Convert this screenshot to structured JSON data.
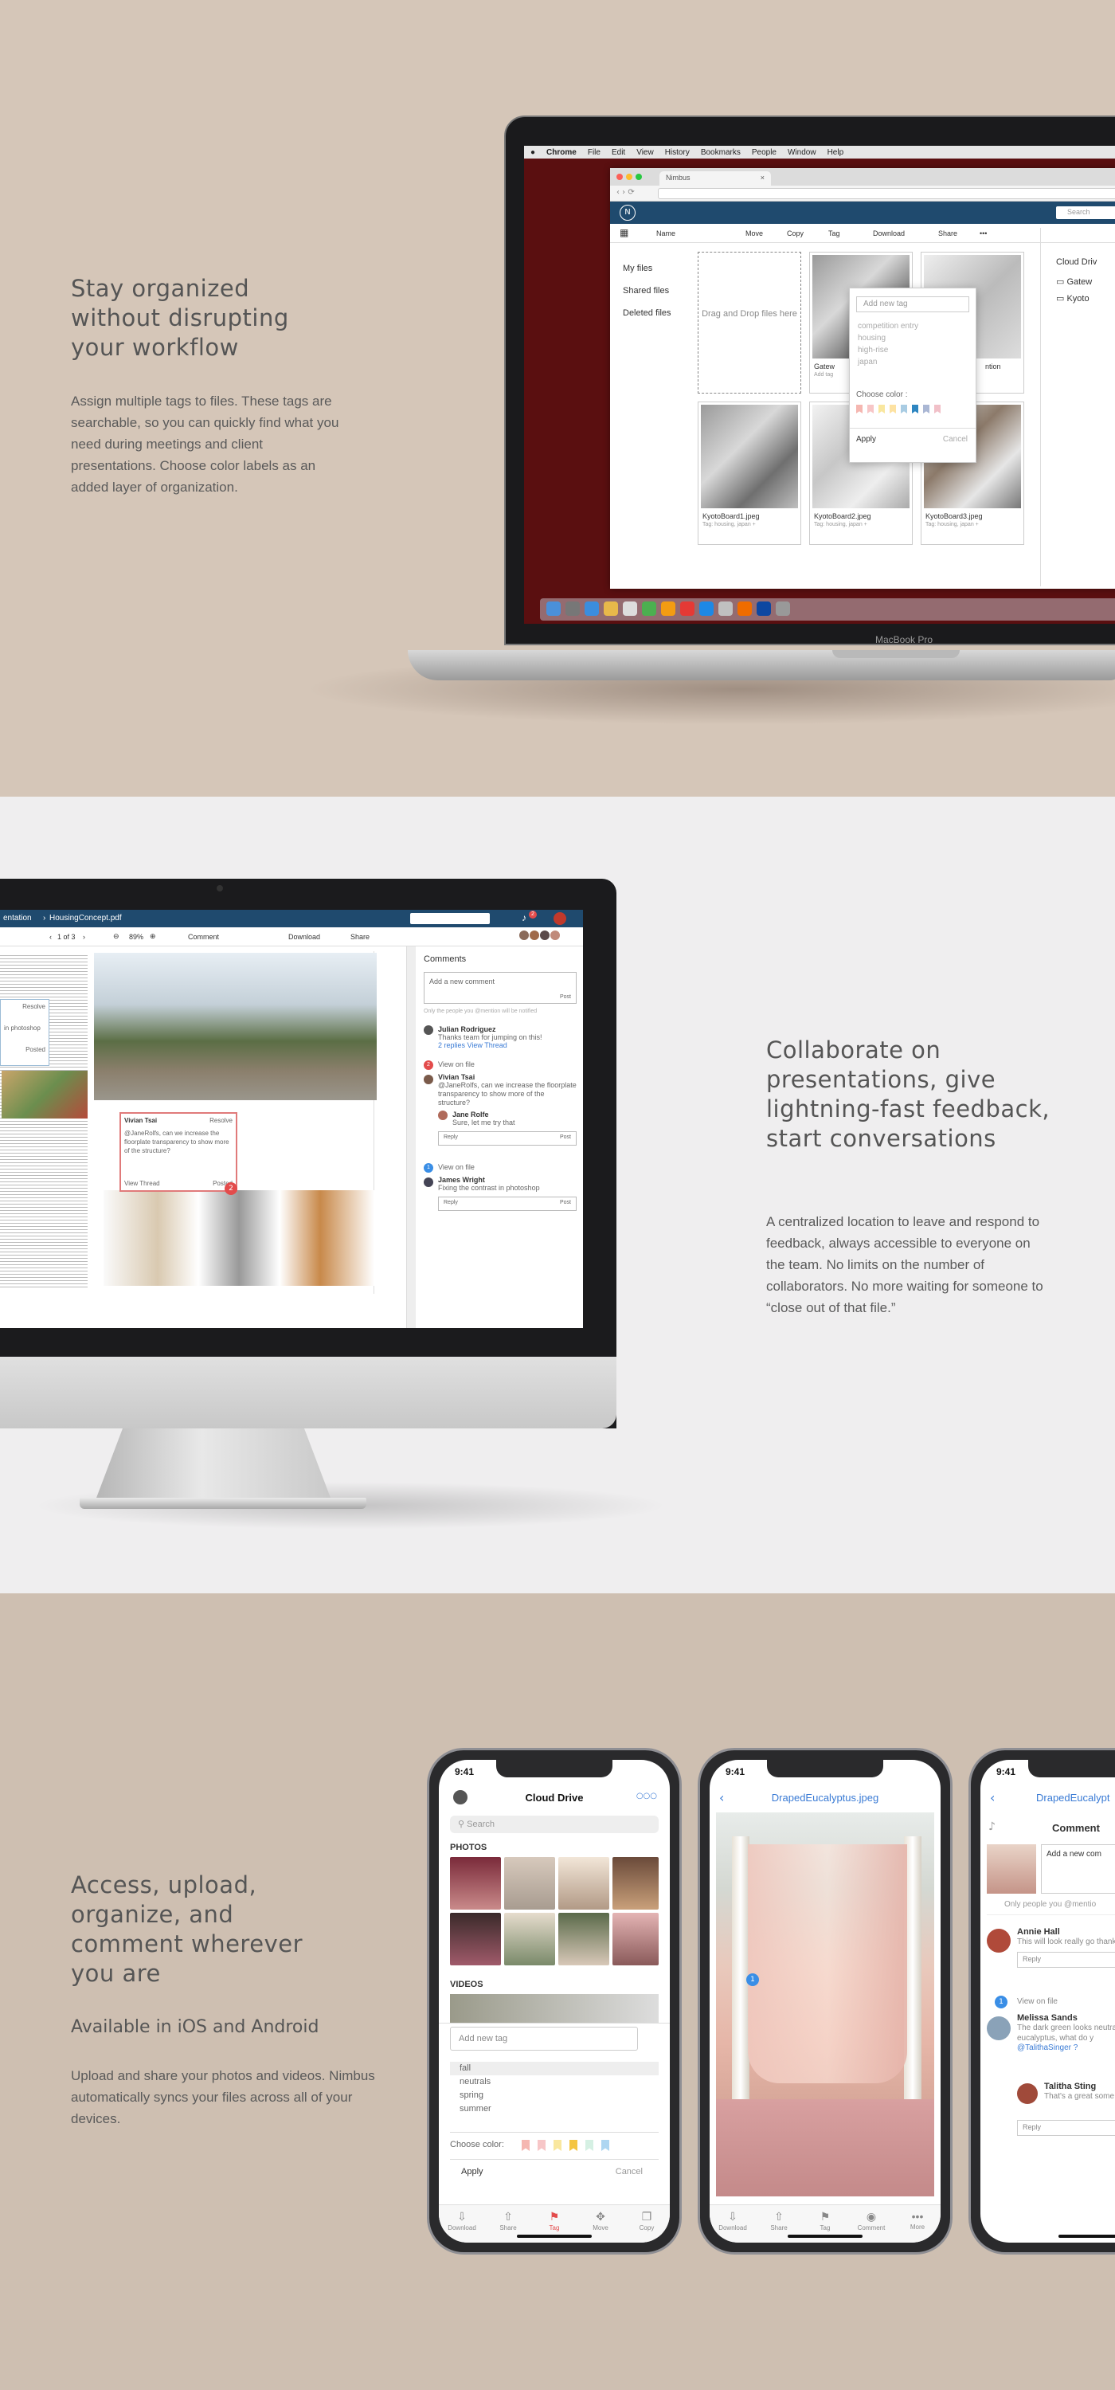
{
  "section1": {
    "heading": "Stay organized without disrupting your workflow",
    "body": "Assign multiple tags to files. These tags are searchable, so you can quickly find what you need during meetings and client presentations. Choose color labels as an added layer of organization.",
    "laptop_model": "MacBook Pro",
    "mac_menu": [
      "Chrome",
      "File",
      "Edit",
      "View",
      "History",
      "Bookmarks",
      "People",
      "Window",
      "Help"
    ],
    "browser_tab": "Nimbus",
    "app_logo": "N",
    "app_search_placeholder": "Search",
    "toolbar": {
      "sort": "Name",
      "move": "Move",
      "copy": "Copy",
      "tag": "Tag",
      "download": "Download",
      "share": "Share",
      "more": "•••"
    },
    "sidenav": [
      "My files",
      "Shared files",
      "Deleted files"
    ],
    "dropzone": "Drag and Drop files here",
    "thumbs": [
      {
        "name": "KyotoBoard1.jpeg",
        "tag": "Tag: housing, japan +"
      },
      {
        "name": "KyotoBoard2.jpeg",
        "tag": "Tag: housing, japan +"
      },
      {
        "name": "KyotoBoard3.jpeg",
        "tag": "Tag: housing, japan +"
      }
    ],
    "top_thumb_1": "Gatew",
    "top_thumb_1_tag": "Add tag",
    "top_thumb_2": "ntion",
    "tag_popup": {
      "placeholder": "Add new tag",
      "options": [
        "competition entry",
        "housing",
        "high-rise",
        "japan"
      ],
      "choose_color": "Choose color :",
      "apply": "Apply",
      "cancel": "Cancel",
      "colors": [
        "#f5b7b1",
        "#f7c6c7",
        "#f9e79f",
        "#fde2a2",
        "#a9cce3",
        "#2e86c1",
        "#aab7d4",
        "#f1c0c8"
      ]
    },
    "cloud_panel": {
      "title": "Cloud Driv",
      "items": [
        "Gatew",
        "Kyoto"
      ]
    }
  },
  "section2": {
    "heading": "Collaborate on presentations, give lightning-fast feedback, start conversations",
    "body": "A centralized location to leave and respond to feedback, always accessible to everyone on the team.  No limits on the number of collaborators. No more waiting for someone to “close out of that file.”",
    "breadcrumb_prev": "entation",
    "breadcrumb_file": "HousingConcept.pdf",
    "pager": "1 of 3",
    "zoom": "89%",
    "comment_btn": "Comment",
    "download": "Download",
    "share": "Share",
    "notif_count": "2",
    "comments_title": "Comments",
    "new_comment_placeholder": "Add a new comment",
    "post": "Post",
    "notify_note": "Only the people you @mention will be notified",
    "side_label": "Resolve",
    "side_label_2": "in photoshop",
    "side_label_3": "Posted",
    "card": {
      "author": "Vivian Tsai",
      "resolve": "Resolve",
      "text": "@JaneRolfs, can we increase the floorplate transparency to show more of the structure?",
      "view_thread": "View Thread",
      "posted": "Posted"
    },
    "pin": "2",
    "thread": [
      {
        "author": "Julian Rodriguez",
        "text": "Thanks team for jumping on this!",
        "meta": "2 replies  View Thread"
      },
      {
        "badge": "2",
        "view": "View on file",
        "author": "Vivian Tsai",
        "text": "@JaneRolfs, can we increase the floorplate transparency to show more of the structure?",
        "reply_author": "Jane Rolfe",
        "reply_text": "Sure, let me try that",
        "reply": "Reply",
        "post": "Post"
      },
      {
        "badge": "1",
        "view": "View on file",
        "author": "James Wright",
        "text": "Fixing the contrast in photoshop",
        "reply": "Reply",
        "post": "Post"
      }
    ]
  },
  "section3": {
    "heading": "Access, upload, organize, and comment  wherever you are",
    "subheading": "Available in iOS and Android",
    "body": "Upload and share your photos and videos. Nimbus automatically syncs your files across all of your devices.",
    "time": "9:41",
    "phone1": {
      "title": "Cloud Drive",
      "more": "○○○",
      "search": "Search",
      "photos_label": "PHOTOS",
      "videos_label": "VIDEOS",
      "tag_placeholder": "Add new tag",
      "tag_options": [
        "fall",
        "neutrals",
        "spring",
        "summer"
      ],
      "choose_color": "Choose color:",
      "apply": "Apply",
      "cancel": "Cancel",
      "colors": [
        "#f5b7b1",
        "#f7c6c7",
        "#f9e79f",
        "#f4c542",
        "#d5f0e3",
        "#aed6f1"
      ],
      "tabs": [
        "Download",
        "Share",
        "Tag",
        "Move",
        "Copy"
      ]
    },
    "phone2": {
      "title": "DrapedEucalyptus.jpeg",
      "pin": "1",
      "tabs": [
        "Download",
        "Share",
        "Tag",
        "Comment",
        "More"
      ]
    },
    "phone3": {
      "title": "DrapedEucalypt",
      "heading": "Comment",
      "new_comment": "Add a new com",
      "note": "Only people you @mentio",
      "comments": [
        {
          "author": "Annie Hall",
          "text": "This will look really go thanks for all the hard",
          "reply": "Reply"
        },
        {
          "badge": "1",
          "view": "View on file",
          "author": "Melissa Sands",
          "text": "The dark green looks neutral, we can add s eucalyptus, what do y",
          "mention": "@TalithaSinger ?"
        },
        {
          "author": "Talitha Sting",
          "text": "That's a great some to test it",
          "reply": "Reply"
        }
      ]
    }
  }
}
